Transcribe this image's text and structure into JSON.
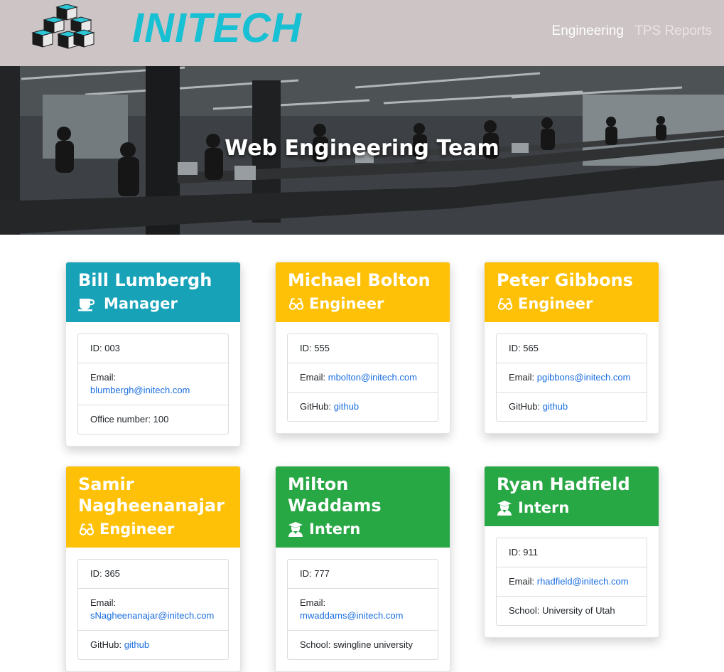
{
  "nav": {
    "brand": "INITECH",
    "links": [
      {
        "label": "Engineering"
      },
      {
        "label": "TPS Reports"
      }
    ]
  },
  "hero": {
    "title": "Web Engineering Team"
  },
  "colors": {
    "manager": "#17a2b8",
    "engineer": "#ffc107",
    "intern": "#28a745",
    "link": "#1a6ee0",
    "brand": "#17c0d2",
    "navbar": "#cdc4c6"
  },
  "employees": [
    {
      "name": "Bill Lumbergh",
      "role": "Manager",
      "icon": "coffee-mug-icon",
      "id_label": "ID: 003",
      "email_label": "Email: ",
      "email": "blumbergh@initech.com",
      "extra_label": "Office number: 100",
      "extra_link": ""
    },
    {
      "name": "Michael Bolton",
      "role": "Engineer",
      "icon": "glasses-icon",
      "id_label": "ID: 555",
      "email_label": "Email: ",
      "email": "mbolton@initech.com",
      "extra_label": "GitHub: ",
      "extra_link": "github"
    },
    {
      "name": "Peter Gibbons",
      "role": "Engineer",
      "icon": "glasses-icon",
      "id_label": "ID: 565",
      "email_label": "Email: ",
      "email": "pgibbons@initech.com",
      "extra_label": "GitHub: ",
      "extra_link": "github"
    },
    {
      "name": "Samir Nagheenanajar",
      "role": "Engineer",
      "icon": "glasses-icon",
      "id_label": "ID: 365",
      "email_label": "Email:",
      "email": "sNagheenanajar@initech.com",
      "extra_label": "GitHub: ",
      "extra_link": "github"
    },
    {
      "name": "Milton Waddams",
      "role": "Intern",
      "icon": "graduate-icon",
      "id_label": "ID: 777",
      "email_label": "Email: ",
      "email": "mwaddams@initech.com",
      "extra_label": "School: swingline university",
      "extra_link": ""
    },
    {
      "name": "Ryan Hadfield",
      "role": "Intern",
      "icon": "graduate-icon",
      "id_label": "ID: 911",
      "email_label": "Email: ",
      "email": "rhadfield@initech.com",
      "extra_label": "School: University of Utah",
      "extra_link": ""
    }
  ]
}
